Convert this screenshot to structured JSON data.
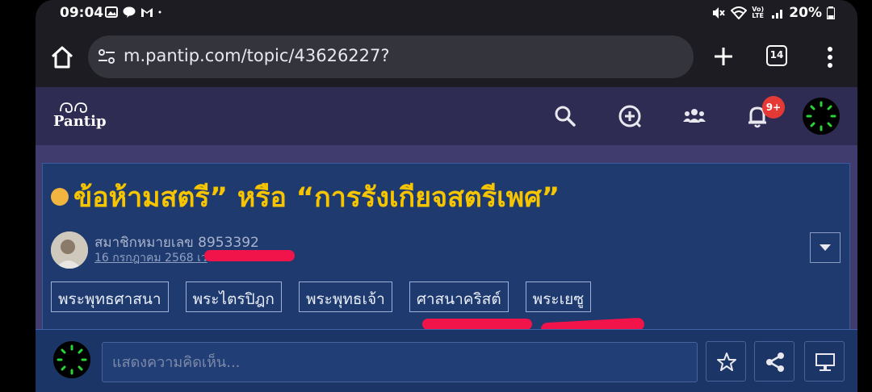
{
  "status_bar": {
    "time": "09:04",
    "battery": "20%",
    "network": "Vo) LTE"
  },
  "browser": {
    "url": "m.pantip.com/topic/43626227?",
    "tab_count": "14"
  },
  "pantip": {
    "logo_text": "Pantip",
    "notification_badge": "9+"
  },
  "topic": {
    "title": "ข้อห้ามสตรี” หรือ “การรังเกียจสตรีเพศ”",
    "author": "สมาชิกหมายเลข 8953392",
    "date": "16 กรกฎาคม 2568 เว",
    "tags": [
      "พระพุทธศาสนา",
      "พระไตรปิฎก",
      "พระพุทธเจ้า",
      "ศาสนาคริสต์",
      "พระเยซู"
    ]
  },
  "comment": {
    "placeholder": "แสดงความคิดเห็น..."
  },
  "colors": {
    "title": "#f6c500",
    "highlight": "#f0144a",
    "nav_bg": "#2e2c52",
    "topic_bg": "#1f3a6e"
  }
}
